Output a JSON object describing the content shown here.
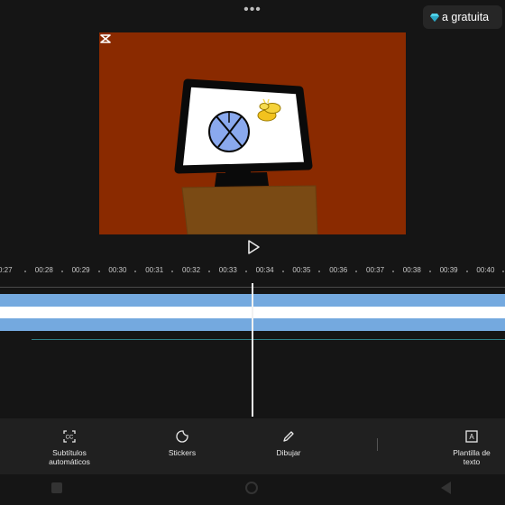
{
  "header": {
    "more_icon": "more-horizontal-icon",
    "pro_label": "a gratuita",
    "pro_icon": "diamond-icon",
    "pro_icon_color": "#4fd1e8"
  },
  "preview": {
    "background_color": "#8a2a00",
    "watermark_icon": "capcut-logo-icon"
  },
  "playback": {
    "play_icon": "play-icon"
  },
  "ruler": {
    "ticks": [
      "0:27",
      "00:28",
      "00:29",
      "00:30",
      "00:31",
      "00:32",
      "00:33",
      "00:34",
      "00:35",
      "00:36",
      "00:37",
      "00:38",
      "00:39",
      "00:40"
    ]
  },
  "timeline": {
    "track_color": "#74a9df",
    "text_track_color": "#2f7f86"
  },
  "toolbar": {
    "items": [
      {
        "label": "Subtítulos automáticos",
        "icon": "auto-captions-icon"
      },
      {
        "label": "Stickers",
        "icon": "sticker-icon"
      },
      {
        "label": "Dibujar",
        "icon": "pencil-icon"
      },
      {
        "label": "Plantilla de texto",
        "icon": "text-template-icon"
      }
    ]
  },
  "navbar": {
    "icons": [
      "recent-apps-icon",
      "home-icon",
      "back-icon"
    ]
  }
}
